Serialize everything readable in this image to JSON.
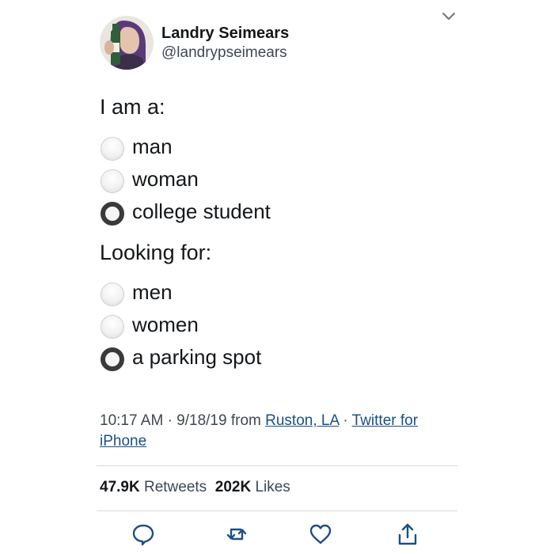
{
  "author": {
    "display_name": "Landry Seimears",
    "handle": "@landrypseimears"
  },
  "poll": {
    "i_am": {
      "label": "I am a:",
      "options": [
        {
          "label": "man",
          "selected": false
        },
        {
          "label": "woman",
          "selected": false
        },
        {
          "label": "college student",
          "selected": true
        }
      ]
    },
    "looking_for": {
      "label": "Looking for:",
      "options": [
        {
          "label": "men",
          "selected": false
        },
        {
          "label": "women",
          "selected": false
        },
        {
          "label": "a parking spot",
          "selected": true
        }
      ]
    }
  },
  "meta": {
    "time": "10:17 AM",
    "sep1": "·",
    "date": "9/18/19",
    "from": "from",
    "location": "Ruston, LA",
    "sep2": "·",
    "client": "Twitter for iPhone"
  },
  "stats": {
    "retweets_count": "47.9K",
    "retweets_label": "Retweets",
    "likes_count": "202K",
    "likes_label": "Likes"
  },
  "actions": {
    "reply_icon": "reply-icon",
    "retweet_icon": "retweet-icon",
    "like_icon": "heart-icon",
    "share_icon": "share-icon"
  },
  "colors": {
    "text": "#14171a",
    "secondary": "#3d4852",
    "link": "#1b4f86",
    "divider": "#d6dbe0",
    "radio_selected": "#3a3a3a"
  }
}
